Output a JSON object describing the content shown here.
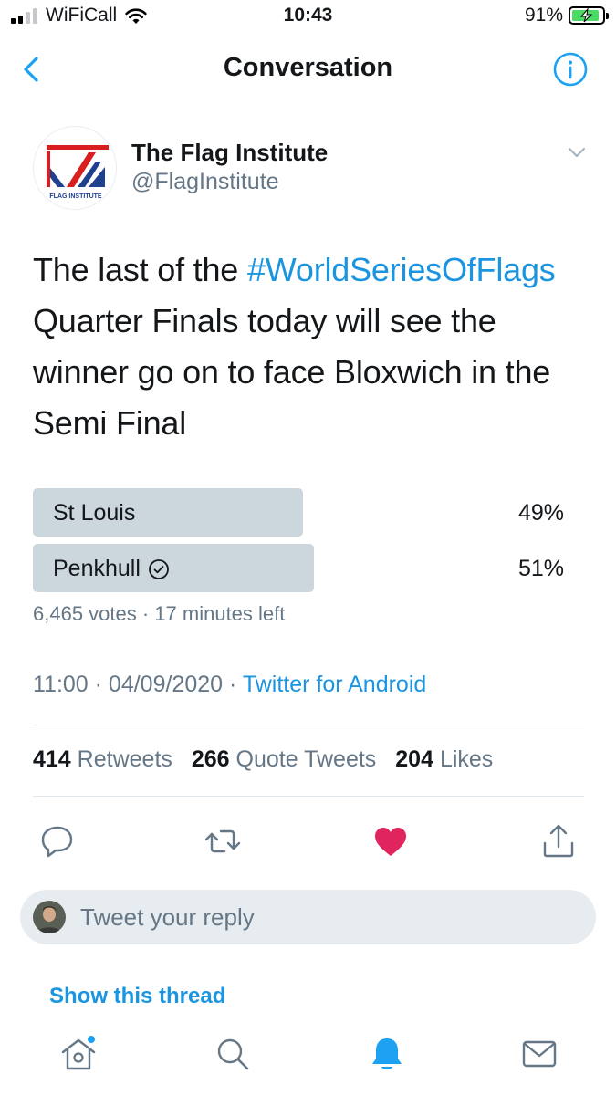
{
  "status_bar": {
    "carrier": "WiFiCall",
    "time": "10:43",
    "battery": "91%",
    "battery_level": 0.91,
    "signal_bars_filled": 2,
    "signal_bars_total": 4
  },
  "header": {
    "title": "Conversation",
    "back_icon": "chevron-left-icon",
    "info_icon": "info-icon"
  },
  "tweet": {
    "author_name": "The Flag Institute",
    "author_handle": "@FlagInstitute",
    "avatar_text": "FLAG INSTITUTE",
    "text_before": "The last of the ",
    "hashtag": "#WorldSeriesOfFlags",
    "text_after": " Quarter Finals today will see the winner go on to face Bloxwich in the Semi Final",
    "poll": {
      "options": [
        {
          "label": "St Louis",
          "percent_text": "49%",
          "percent": 49,
          "chosen": false
        },
        {
          "label": "Penkhull",
          "percent_text": "51%",
          "percent": 51,
          "chosen": true
        }
      ],
      "meta": "6,465 votes · 17 minutes left"
    },
    "time": "11:00 · 04/09/2020 · ",
    "source": "Twitter for Android",
    "stats": {
      "retweets_count": "414",
      "retweets_label": "Retweets",
      "quotes_count": "266",
      "quotes_label": "Quote Tweets",
      "likes_count": "204",
      "likes_label": "Likes"
    }
  },
  "reply": {
    "placeholder": "Tweet your reply"
  },
  "show_thread": "Show this thread",
  "colors": {
    "accent": "#1da1f2",
    "link": "#1b95e0",
    "like": "#e0245e",
    "poll_bar": "#ccd6dd",
    "muted": "#657786"
  }
}
